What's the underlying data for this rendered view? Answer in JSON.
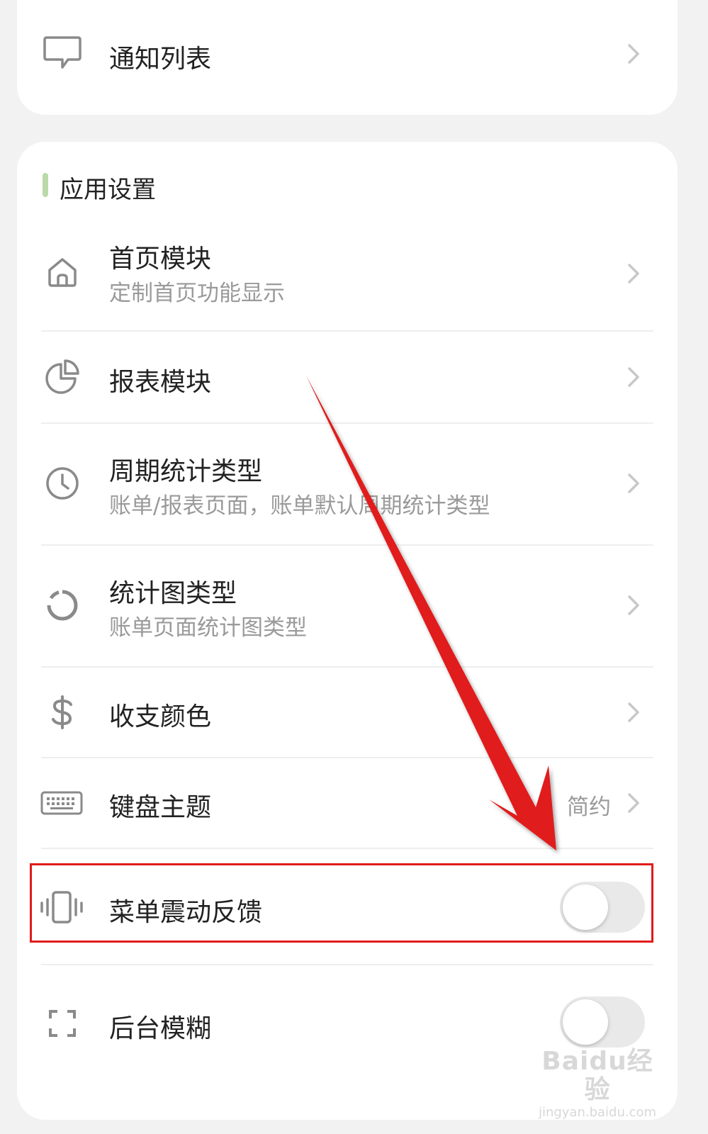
{
  "top_card": {
    "item": {
      "icon": "message-bubble-icon",
      "title": "通知列表"
    }
  },
  "settings": {
    "section_title": "应用设置",
    "items": [
      {
        "icon": "home-icon",
        "title": "首页模块",
        "subtitle": "定制首页功能显示"
      },
      {
        "icon": "pie-chart-icon",
        "title": "报表模块"
      },
      {
        "icon": "clock-icon",
        "title": "周期统计类型",
        "subtitle": "账单/报表页面，账单默认周期统计类型"
      },
      {
        "icon": "donut-chart-icon",
        "title": "统计图类型",
        "subtitle": "账单页面统计图类型"
      },
      {
        "icon": "dollar-icon",
        "title": "收支颜色"
      },
      {
        "icon": "keyboard-icon",
        "title": "键盘主题",
        "value": "简约"
      },
      {
        "icon": "vibration-icon",
        "title": "菜单震动反馈",
        "toggle": false
      },
      {
        "icon": "fullscreen-icon",
        "title": "后台模糊",
        "toggle": false
      }
    ]
  },
  "annotation": {
    "arrow_color": "#e01b1b",
    "highlight_color": "#e01b1b"
  },
  "watermark": {
    "main": "Baidu经验",
    "url": "jingyan.baidu.com"
  }
}
